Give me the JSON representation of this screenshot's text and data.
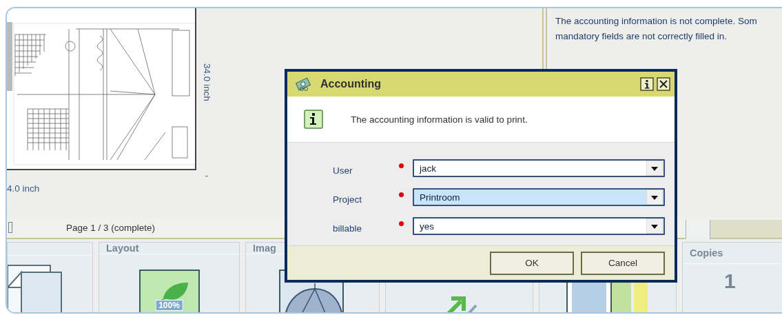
{
  "preview": {
    "width_label": "4.0 inch",
    "height_label": "34.0 inch",
    "tick": "-"
  },
  "message_lines": [
    "The accounting information is not complete. Som",
    "mandatory fields are not correctly filled in."
  ],
  "page_status": "Page 1 / 3 (complete)",
  "tiles": [
    {
      "kind": "pages"
    },
    {
      "kind": "layout",
      "title": "Layout",
      "badge": "100%"
    },
    {
      "kind": "image",
      "title": "Imag"
    },
    {
      "kind": "arrow"
    },
    {
      "kind": "color"
    },
    {
      "kind": "copies",
      "title": "Copies",
      "value": "1"
    }
  ],
  "dialog": {
    "title": "Accounting",
    "message": "The accounting information is valid to print.",
    "fields": [
      {
        "label": "User",
        "required": true,
        "value": "jack",
        "focused": false
      },
      {
        "label": "Project",
        "required": true,
        "value": "Printroom",
        "focused": true
      },
      {
        "label": "billable",
        "required": true,
        "value": "yes",
        "focused": false
      }
    ],
    "buttons": [
      "OK",
      "Cancel"
    ]
  }
}
